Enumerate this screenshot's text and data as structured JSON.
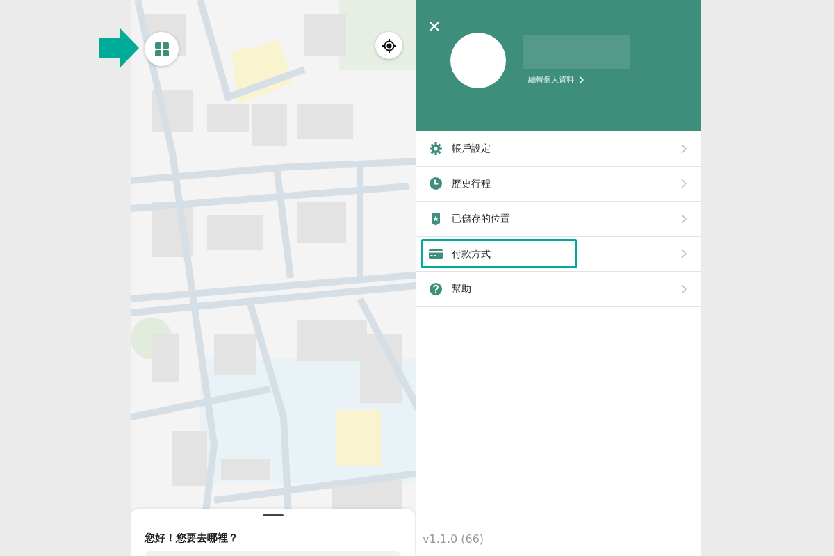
{
  "map": {
    "menu_button": {
      "pointed_at": true
    }
  },
  "drawer": {
    "profile": {
      "edit_link": "編輯個人資料"
    },
    "items": [
      {
        "kind": "settings",
        "label": "帳戶設定",
        "highlighted": false
      },
      {
        "kind": "history",
        "label": "歷史行程",
        "highlighted": false
      },
      {
        "kind": "saved",
        "label": "已儲存的位置",
        "highlighted": false
      },
      {
        "kind": "payment",
        "label": "付款方式",
        "highlighted": true
      },
      {
        "kind": "help",
        "label": "幫助",
        "highlighted": false
      }
    ],
    "version": "v1.1.0 (66)"
  },
  "sheet": {
    "greeting": "您好！您要去哪裡？"
  }
}
